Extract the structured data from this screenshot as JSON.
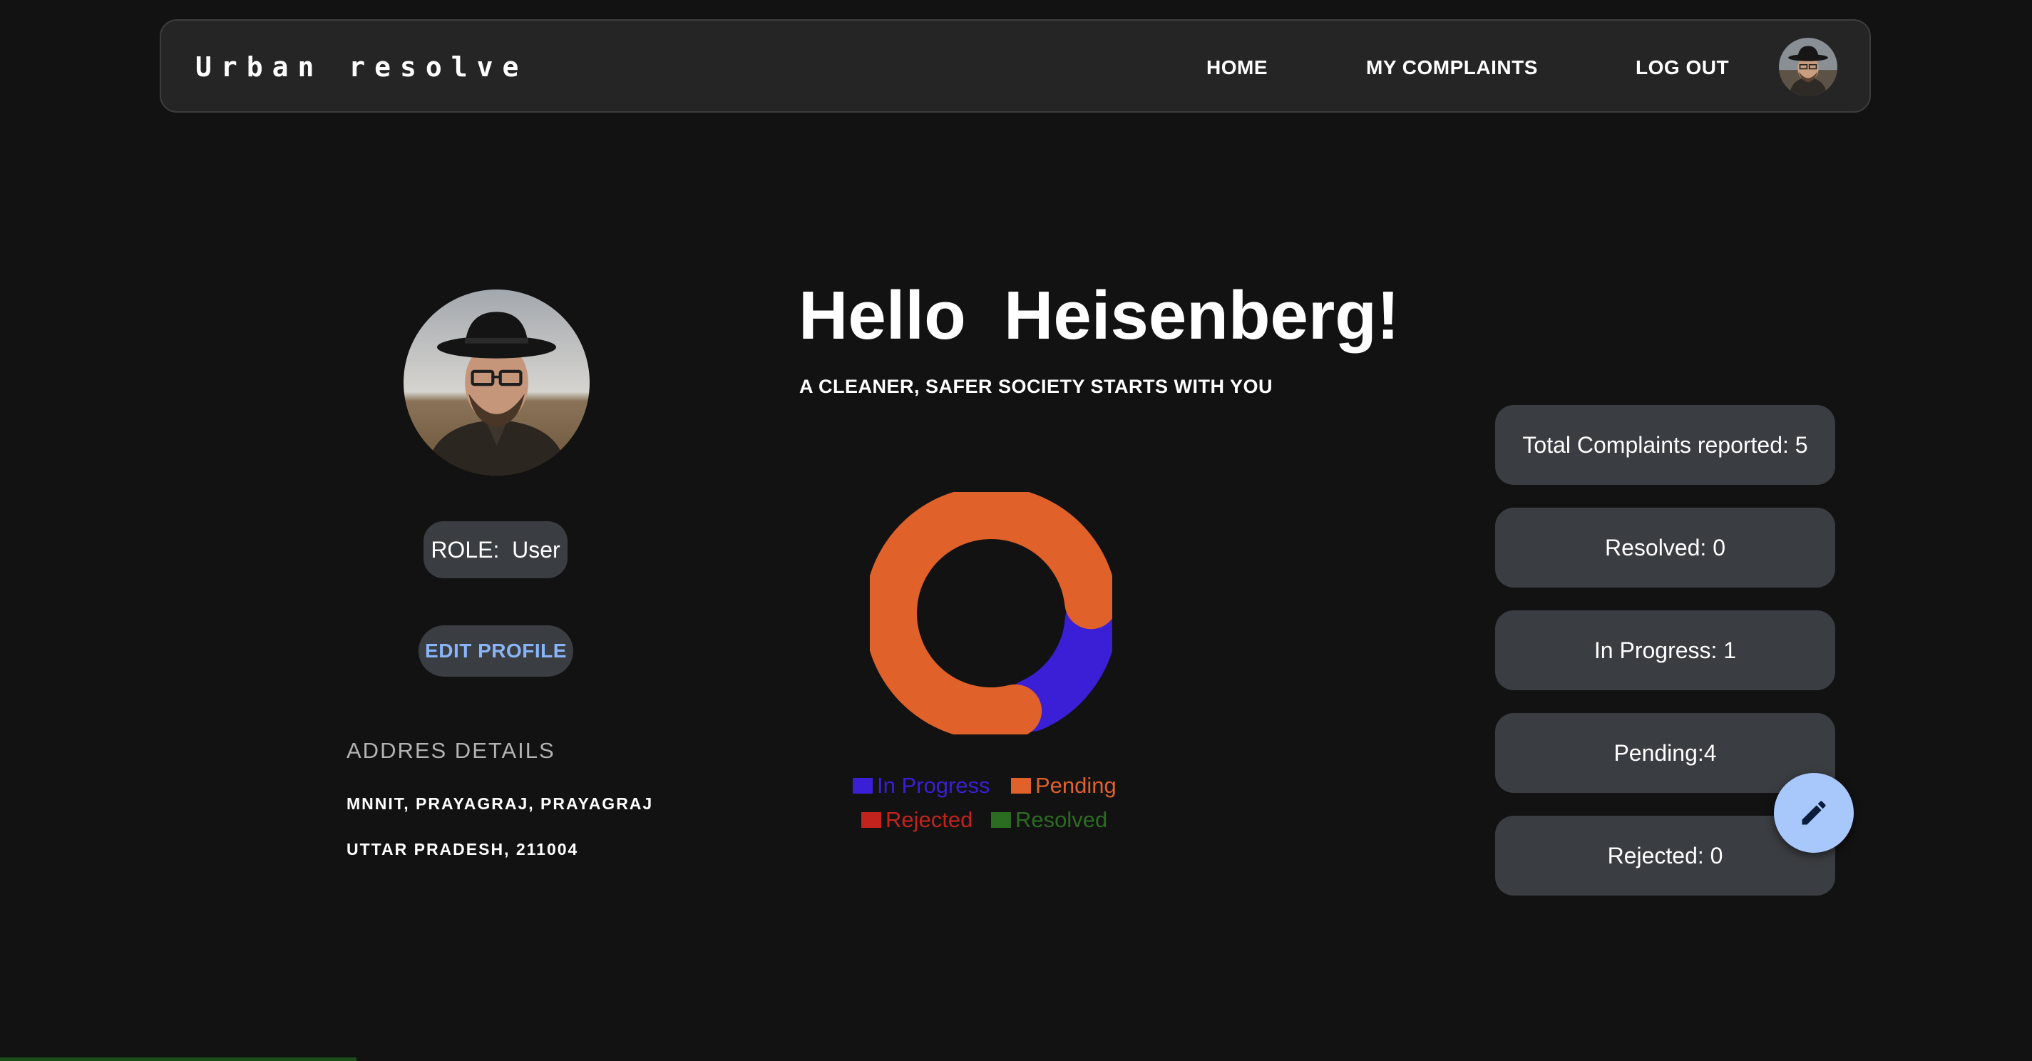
{
  "navbar": {
    "brand": "Urban resolve",
    "links": [
      "HOME",
      "MY COMPLAINTS",
      "LOG OUT"
    ]
  },
  "profile": {
    "role_label": "ROLE:  User",
    "edit_button": "EDIT PROFILE",
    "address_heading": "ADDRES DETAILS",
    "address_line1": "MNNIT, PRAYAGRAJ, PRAYAGRAJ",
    "address_line2": "UTTAR PRADESH, 211004"
  },
  "main": {
    "greeting": "Hello  Heisenberg!",
    "tagline": "A CLEANER, SAFER SOCIETY STARTS WITH YOU"
  },
  "chart_data": {
    "type": "pie",
    "variant": "donut",
    "categories": [
      "In Progress",
      "Pending",
      "Rejected",
      "Resolved"
    ],
    "values": [
      1,
      4,
      0,
      0
    ],
    "colors": [
      "#3a1fd6",
      "#e0612a",
      "#c2241d",
      "#2c6b22"
    ],
    "legend": [
      "In Progress",
      "Pending",
      "Rejected",
      "Resolved"
    ],
    "legend_placement": "bottom"
  },
  "stats": [
    "Total Complaints reported: 5",
    "Resolved: 0",
    "In Progress: 1",
    "Pending:4",
    "Rejected: 0"
  ],
  "icons": {
    "fab": "pencil-icon",
    "avatar": "user-avatar"
  },
  "colors": {
    "background": "#121212",
    "navbar": "#252525",
    "card": "#3a3d41",
    "accent_link": "#8ab4f8",
    "fab": "#a8c7fa"
  }
}
